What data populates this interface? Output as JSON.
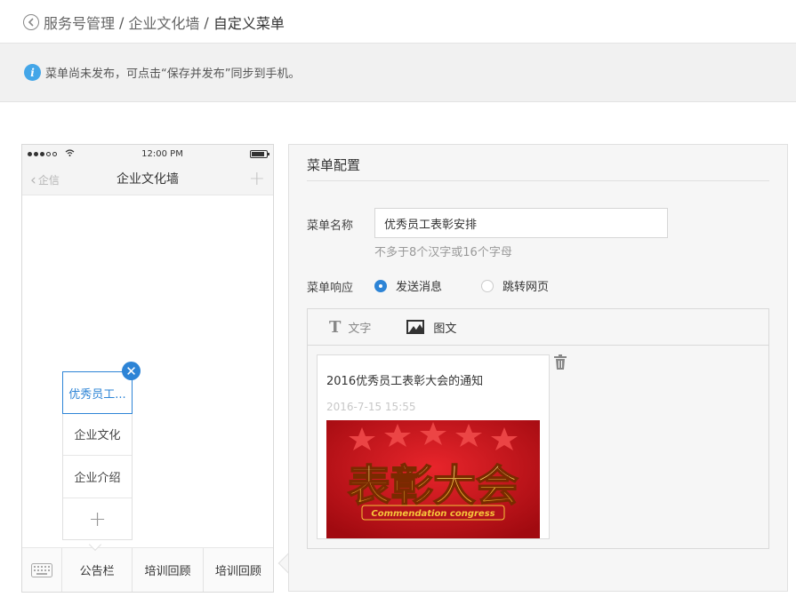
{
  "breadcrumb": {
    "items": [
      "服务号管理",
      "企业文化墙",
      "自定义菜单"
    ],
    "separator": "/"
  },
  "notice": {
    "text": "菜单尚未发布，可点击“保存并发布”同步到手机。"
  },
  "phone": {
    "status": {
      "time": "12:00 PM"
    },
    "nav": {
      "back_label": "企信",
      "title": "企业文化墙"
    },
    "submenu": {
      "items": [
        "优秀员工...",
        "企业文化",
        "企业介绍"
      ],
      "active_index": 0,
      "add_symbol": "+",
      "remove_symbol": "✕"
    },
    "menubar": {
      "items": [
        "公告栏",
        "培训回顾",
        "培训回顾"
      ]
    }
  },
  "config": {
    "title": "菜单配置",
    "name_label": "菜单名称",
    "name_value": "优秀员工表彰安排",
    "name_hint": "不多于8个汉字或16个字母",
    "response_label": "菜单响应",
    "response_options": [
      {
        "label": "发送消息",
        "checked": true
      },
      {
        "label": "跳转网页",
        "checked": false
      }
    ],
    "tabs": [
      {
        "icon": "text-icon",
        "glyph": "T",
        "label": "文字",
        "active": false
      },
      {
        "icon": "image-icon",
        "label": "图文",
        "active": true
      }
    ],
    "article": {
      "title": "2016优秀员工表彰大会的通知",
      "date": "2016-7-15 15:55",
      "image_text": "表彰大会",
      "image_subtext": "Commendation congress"
    }
  },
  "colors": {
    "accent": "#2d84d6",
    "info": "#44a6e8",
    "banner_red": "#c8161d",
    "banner_gold": "#f6c53a"
  }
}
